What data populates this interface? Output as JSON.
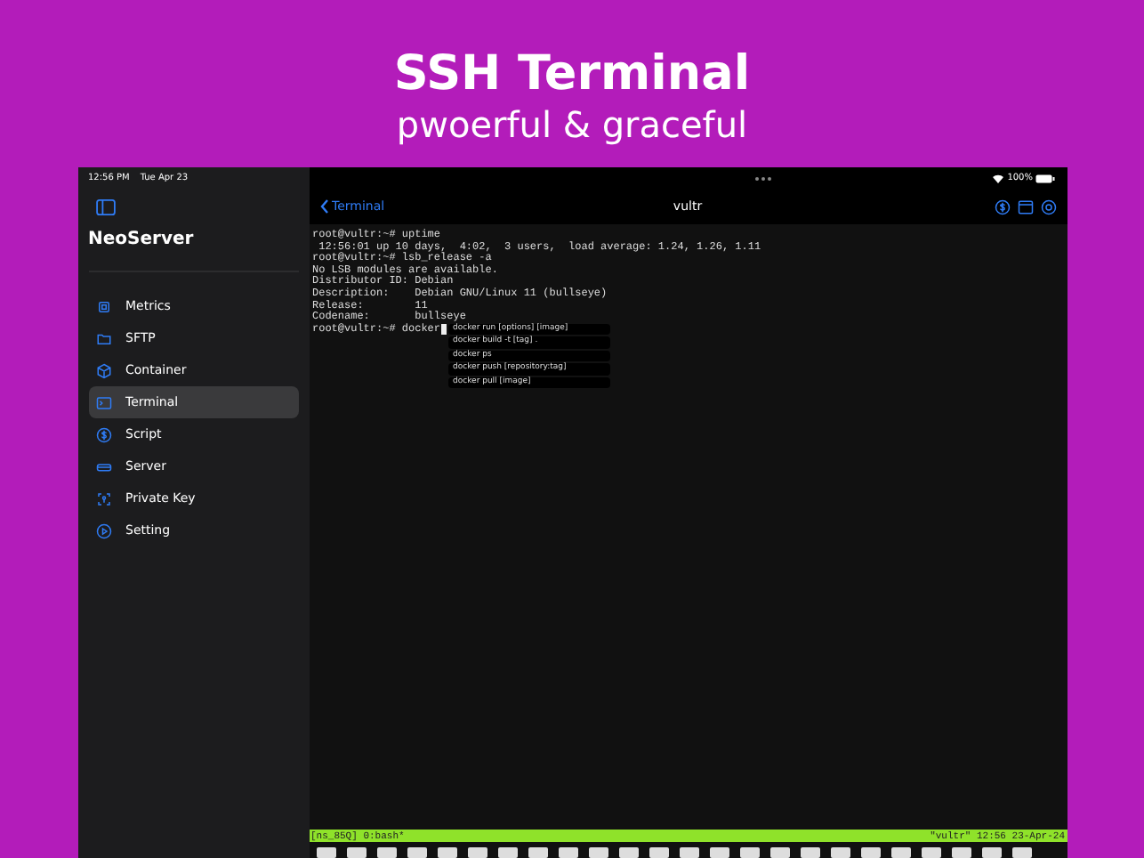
{
  "promo": {
    "title": "SSH Terminal",
    "subtitle": "pwoerful & graceful"
  },
  "status_bar": {
    "time": "12:56 PM",
    "date": "Tue Apr 23",
    "battery": "100%"
  },
  "sidebar": {
    "app_name": "NeoServer",
    "items": [
      {
        "label": "Metrics",
        "selected": false
      },
      {
        "label": "SFTP",
        "selected": false
      },
      {
        "label": "Container",
        "selected": false
      },
      {
        "label": "Terminal",
        "selected": true
      },
      {
        "label": "Script",
        "selected": false
      },
      {
        "label": "Server",
        "selected": false
      },
      {
        "label": "Private Key",
        "selected": false
      },
      {
        "label": "Setting",
        "selected": false
      }
    ]
  },
  "nav": {
    "back": "Terminal",
    "title": "vultr"
  },
  "terminal": {
    "lines": [
      "root@vultr:~# uptime",
      " 12:56:01 up 10 days,  4:02,  3 users,  load average: 1.24, 1.26, 1.11",
      "root@vultr:~# lsb_release -a",
      "No LSB modules are available.",
      "Distributor ID: Debian",
      "Description:    Debian GNU/Linux 11 (bullseye)",
      "Release:        11",
      "Codename:       bullseye"
    ],
    "prompt": "root@vultr:~# docker",
    "suggestions": [
      "docker run [options] [image]",
      "docker build -t [tag] .",
      "docker ps",
      "docker push [repository:tag]",
      "docker pull [image]"
    ],
    "tmux_left": "[ns_85Q] 0:bash*",
    "tmux_right": "\"vultr\" 12:56 23-Apr-24"
  }
}
